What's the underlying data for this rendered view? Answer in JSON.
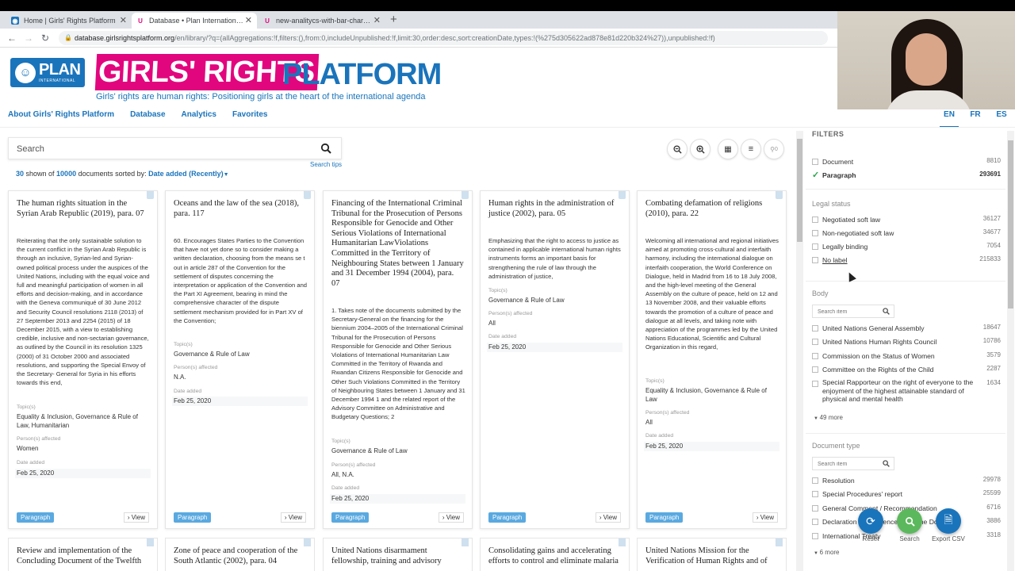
{
  "browser": {
    "tabs": [
      {
        "title": "Home | Girls' Rights Platform",
        "icon": "plan-favicon"
      },
      {
        "title": "Database • Plan International - G",
        "icon": "plan-u-favicon"
      },
      {
        "title": "new-analitycs-with-bar-chart-no",
        "icon": "plan-u-favicon"
      }
    ],
    "new_tab": "+",
    "url_host": "database.girlsrightsplatform.org",
    "url_path": "/en/library/?q=(allAggregations:!f,filters:(),from:0,includeUnpublished:!f,limit:30,order:desc,sort:creationDate,types:!(%275d305622ad878e81d220b324%27)),unpublished:!f)"
  },
  "header": {
    "plan_logo_text": "PLAN",
    "plan_logo_sub": "INTERNATIONAL",
    "brand_part1": "GIRLS' RIGHTS",
    "brand_part2": "PLATFORM",
    "tagline": "Girls' rights are human rights: Positioning girls at the heart of the international agenda",
    "nav": [
      "About Girls' Rights Platform",
      "Database",
      "Analytics",
      "Favorites"
    ],
    "languages": [
      "EN",
      "FR",
      "ES"
    ]
  },
  "search": {
    "placeholder": "Search",
    "tips": "Search tips",
    "pin_count": "0"
  },
  "results": {
    "shown": "30",
    "shown_label": " shown of ",
    "total": "10000",
    "sorted_label": " documents sorted by: ",
    "sort": "Date added (Recently)"
  },
  "labels": {
    "topics": "Topic(s)",
    "persons": "Person(s) affected",
    "date": "Date added",
    "view": "View"
  },
  "cards": [
    {
      "title": "The human rights situation in the Syrian Arab Republic (2019), para. 07",
      "body": "Reiterating that the only sustainable solution to the current conflict in the Syrian Arab Republic is through an inclusive, Syrian-led and Syrian-owned political process under the auspices of the United Nations, including with the equal voice and full and meaningful participation of women in all efforts and decision-making, and in accordance with the Geneva communiqué of 30 June 2012 and Security Council resolutions 2118 (2013) of 27 September 2013 and 2254 (2015) of 18 December 2015, with a view to establishing credible, inclusive and non-sectarian governance, as outlined by the Council in its resolution 1325 (2000) of 31 October 2000 and associated resolutions, and supporting the Special Envoy of the Secretary- General for Syria in his efforts towards this end,",
      "topics": "Equality & Inclusion, Governance & Rule of Law, Humanitarian",
      "persons": "Women",
      "date": "Feb 25, 2020",
      "tag": "Paragraph"
    },
    {
      "title": "Oceans and the law of the sea (2018), para. 117",
      "body": "60. Encourages States Parties to the Convention that have not yet done so to consider making a written declaration, choosing from the means se t out in article 287 of the Convention for the settlement of disputes concerning the interpretation or application of the Convention and the Part XI Agreement, bearing in mind the comprehensive character of the dispute settlement mechanism provided for in Part XV of the Convention;",
      "topics": "Governance & Rule of Law",
      "persons": "N.A.",
      "date": "Feb 25, 2020",
      "tag": "Paragraph"
    },
    {
      "title": "Financing of the International Criminal Tribunal for the Prosecution of Persons Responsible for Genocide and Other Serious Violations of International Humanitarian LawViolations Committed in the Territory of Neighbouring States between 1 January and 31 December 1994 (2004), para. 07",
      "body": "1. Takes note of the documents submitted by the Secretary-General on the financing for the biennium 2004–2005 of the International Criminal Tribunal for the Prosecution of Persons Responsible for Genocide and Other Serious Violations of International Humanitarian Law Committed in the Territory of Rwanda and Rwandan Citizens Responsible for Genocide and Other Such Violations Committed in the Territory of Neighbouring States between 1 January and 31 December 1994 1 and the related report of the Advisory Committee on Administrative and Budgetary Questions; 2",
      "topics": "Governance & Rule of Law",
      "persons": "All, N.A.",
      "date": "Feb 25, 2020",
      "tag": "Paragraph"
    },
    {
      "title": "Human rights in the administration of justice (2002), para. 05",
      "body": "Emphasizing that the right to access to justice as contained in applicable international human rights instruments forms an important basis for strengthening the rule of law through the administration of justice,",
      "topics": "Governance & Rule of Law",
      "persons": "All",
      "date": "Feb 25, 2020",
      "tag": "Paragraph"
    },
    {
      "title": "Combating defamation of religions (2010), para. 22",
      "body": "Welcoming all international and regional initiatives aimed at promoting cross-cultural and interfaith harmony, including the international dialogue on interfaith cooperation, the World Conference on Dialogue, held in Madrid from 16 to 18 July 2008, and the high-level meeting of the General Assembly on the culture of peace, held on 12 and 13 November 2008, and their valuable efforts towards the promotion of a culture of peace and dialogue at all levels, and taking note with appreciation of the programmes led by the United Nations Educational, Scientific and Cultural Organization in this regard,",
      "topics": "Equality & Inclusion, Governance & Rule of Law",
      "persons": "All",
      "date": "Feb 25, 2020",
      "tag": "Paragraph"
    }
  ],
  "cards_row2": [
    "Review and implementation of the Concluding Document of the Twelfth",
    "Zone of peace and cooperation of the South Atlantic (2002), para. 04",
    "United Nations disarmament fellowship, training and advisory",
    "Consolidating gains and accelerating efforts to control and eliminate malaria",
    "United Nations Mission for the Verification of Human Rights and of"
  ],
  "filters": {
    "heading": "FILTERS",
    "types": [
      {
        "label": "Document",
        "count": "8810",
        "selected": false
      },
      {
        "label": "Paragraph",
        "count": "293691",
        "selected": true
      }
    ],
    "legal_status_title": "Legal status",
    "legal_status": [
      {
        "label": "Negotiated soft law",
        "count": "36127"
      },
      {
        "label": "Non-negotiated soft law",
        "count": "34677"
      },
      {
        "label": "Legally binding",
        "count": "7054"
      },
      {
        "label": "No label",
        "count": "215833"
      }
    ],
    "body_title": "Body",
    "search_placeholder": "Search item",
    "body": [
      {
        "label": "United Nations General Assembly",
        "count": "18647"
      },
      {
        "label": "United Nations Human Rights Council",
        "count": "10786"
      },
      {
        "label": "Commission on the Status of Women",
        "count": "3579"
      },
      {
        "label": "Committee on the Rights of the Child",
        "count": "2287"
      },
      {
        "label": "Special Rapporteur on the right of everyone to the enjoyment of the highest attainable standard of physical and mental health",
        "count": "1634"
      }
    ],
    "body_more": "49 more",
    "doctype_title": "Document type",
    "doctype": [
      {
        "label": "Resolution",
        "count": "29978"
      },
      {
        "label": "Special Procedures' report",
        "count": "25599"
      },
      {
        "label": "General Comment / Recommendation",
        "count": "6716"
      },
      {
        "label": "Declaration / Conference Outcome Document",
        "count": "3886"
      },
      {
        "label": "International Treaty",
        "count": "3318"
      }
    ],
    "doctype_more": "6 more"
  },
  "actions": {
    "reset": "Reset",
    "search": "Search",
    "export": "Export CSV",
    "colors": {
      "reset": "#1a74bb",
      "search": "#5cb85c",
      "export": "#1a74bb"
    }
  },
  "colors": {
    "brand_blue": "#1a74bb",
    "brand_pink": "#e2067e",
    "tag_blue": "#5aa9e0"
  }
}
